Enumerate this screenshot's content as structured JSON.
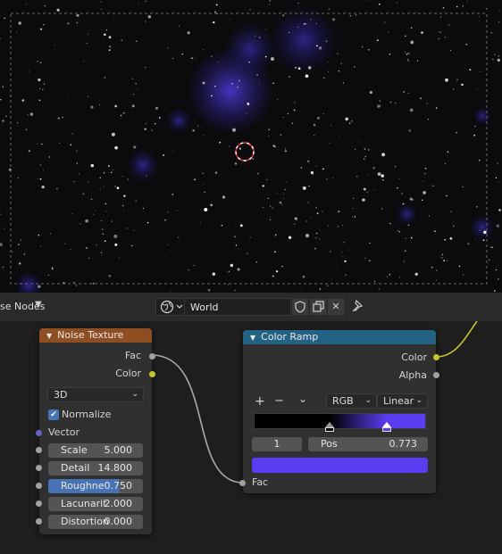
{
  "header": {
    "title": "se Nodes",
    "world_name": "World",
    "icons": [
      "chevron-down-icon",
      "world-icon",
      "shield-icon",
      "duplicate-icon",
      "close-icon",
      "pin-icon"
    ]
  },
  "noise_node": {
    "title": "Noise Texture",
    "header_color": "#8f4d22",
    "outputs": [
      "Fac",
      "Color"
    ],
    "dimension": "3D",
    "normalize_label": "Normalize",
    "normalize_checked": true,
    "vector_label": "Vector",
    "params": [
      {
        "label": "Scale",
        "value": "5.000"
      },
      {
        "label": "Detail",
        "value": "14.800"
      },
      {
        "label": "Roughne",
        "value": "0.750",
        "fill": 0.75
      },
      {
        "label": "Lacunarit",
        "value": "2.000"
      },
      {
        "label": "Distortion",
        "value": "0.000"
      }
    ]
  },
  "ramp_node": {
    "title": "Color Ramp",
    "header_color": "#246283",
    "outputs": [
      "Color",
      "Alpha"
    ],
    "add": "+",
    "remove": "−",
    "menu": "⌄",
    "color_mode": "RGB",
    "interpolation": "Linear",
    "stop_index": "1",
    "pos_label": "Pos",
    "pos_value": "0.773",
    "stop_color": "#5b3cf0",
    "input_label": "Fac",
    "stops": [
      {
        "position": 0.443,
        "color": "#000000"
      },
      {
        "position": 0.773,
        "color": "#5b3cf0"
      }
    ]
  }
}
